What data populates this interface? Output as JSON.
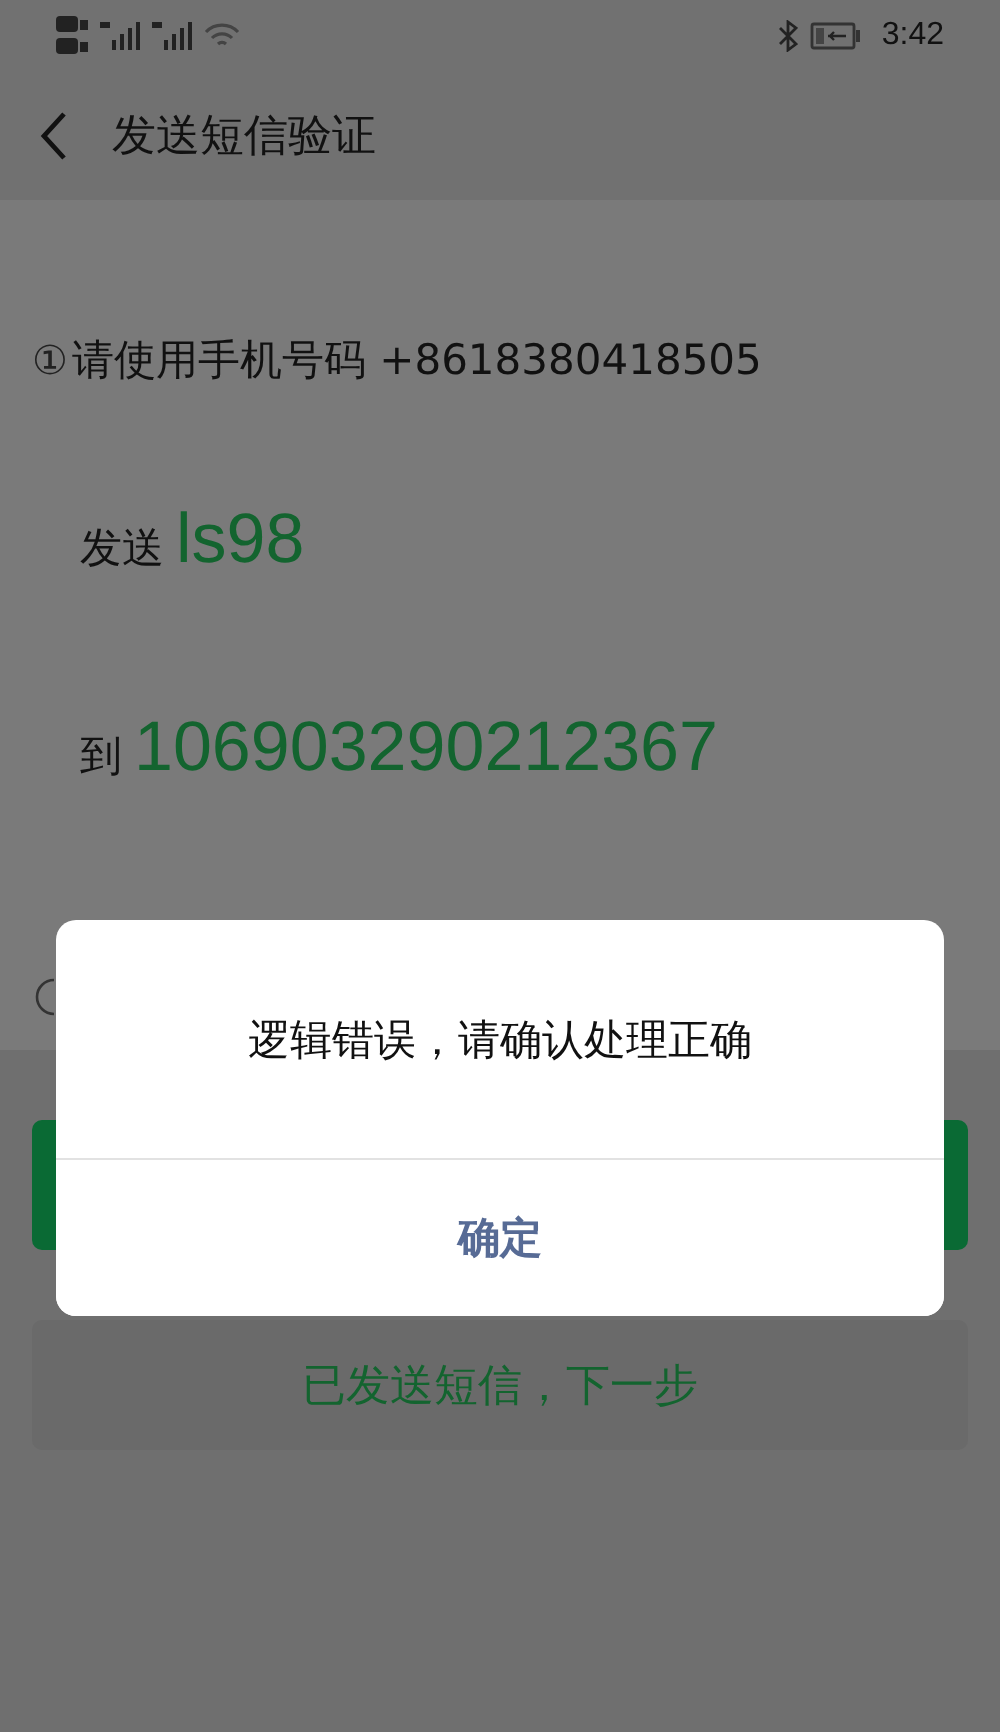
{
  "status_bar": {
    "time": "3:42"
  },
  "header": {
    "title": "发送短信验证"
  },
  "steps": [
    {
      "marker": "①",
      "text": "请使用手机号码 +8618380418505"
    }
  ],
  "send": {
    "label": "发送",
    "code": "ls98"
  },
  "to": {
    "label": "到",
    "number": "106903290212367"
  },
  "buttons": [
    {
      "kind": "primary"
    },
    {
      "kind": "secondary",
      "label": "已发送短信，下一步"
    }
  ],
  "dialog": {
    "message": "逻辑错误，请确认处理正确",
    "confirm": "确定"
  }
}
